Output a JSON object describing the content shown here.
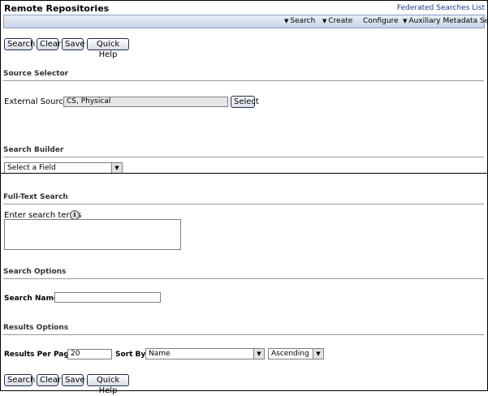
{
  "header": {
    "title": "Remote Repositories",
    "federated_link": "Federated Searches List"
  },
  "menu": {
    "search": "Search",
    "create": "Create",
    "configure": "Configure",
    "auxiliary": "Auxiliary Metadata Set"
  },
  "buttons": {
    "search": "Search",
    "clear": "Clear",
    "save": "Save",
    "quick_help": "Quick Help"
  },
  "source_selector": {
    "heading": "Source Selector",
    "label": "External Sources",
    "value": "CS, Physical",
    "select_button": "Select"
  },
  "search_builder": {
    "heading": "Search Builder",
    "field_select": "Select a Field"
  },
  "full_text": {
    "heading": "Full-Text Search",
    "label": "Enter search terms"
  },
  "search_options": {
    "heading": "Search Options",
    "name_label": "Search Name:",
    "name_value": ""
  },
  "results_options": {
    "heading": "Results Options",
    "per_page_label": "Results Per Page:",
    "per_page_value": "20",
    "sort_by_label": "Sort By:",
    "sort_by_value": "Name",
    "order_value": "Ascending"
  },
  "icons": {
    "chevron": "chevron-down-icon",
    "info": "info-icon"
  }
}
